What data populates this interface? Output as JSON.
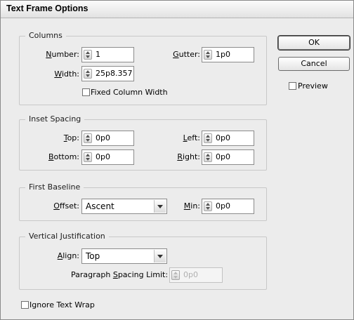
{
  "dialog": {
    "title": "Text Frame Options"
  },
  "columns": {
    "legend": "Columns",
    "number_label_u": "N",
    "number_label_rest": "umber:",
    "number_value": "1",
    "gutter_label_u": "G",
    "gutter_label_rest": "utter:",
    "gutter_value": "1p0",
    "width_label_u": "W",
    "width_label_rest": "idth:",
    "width_value": "25p8.357",
    "fixed_width_label": "Fixed Column Width"
  },
  "inset": {
    "legend": "Inset Spacing",
    "top_label_u": "T",
    "top_label_rest": "op:",
    "top_value": "0p0",
    "left_label_u": "L",
    "left_label_rest": "eft:",
    "left_value": "0p0",
    "bottom_label_u": "B",
    "bottom_label_rest": "ottom:",
    "bottom_value": "0p0",
    "right_label_u": "R",
    "right_label_rest": "ight:",
    "right_value": "0p0"
  },
  "baseline": {
    "legend": "First Baseline",
    "offset_label_u": "O",
    "offset_label_rest": "ffset:",
    "offset_value": "Ascent",
    "min_label_u": "M",
    "min_label_rest": "in:",
    "min_value": "0p0"
  },
  "vertical": {
    "legend": "Vertical Justification",
    "align_label_u": "A",
    "align_label_rest": "lign:",
    "align_value": "Top",
    "para_label_a": "Paragraph ",
    "para_label_u": "S",
    "para_label_b": "pacing Limit:",
    "para_value": "0p0"
  },
  "ignore_wrap_label": "Ignore Text Wrap",
  "buttons": {
    "ok": "OK",
    "cancel": "Cancel"
  },
  "preview_label": "Preview"
}
